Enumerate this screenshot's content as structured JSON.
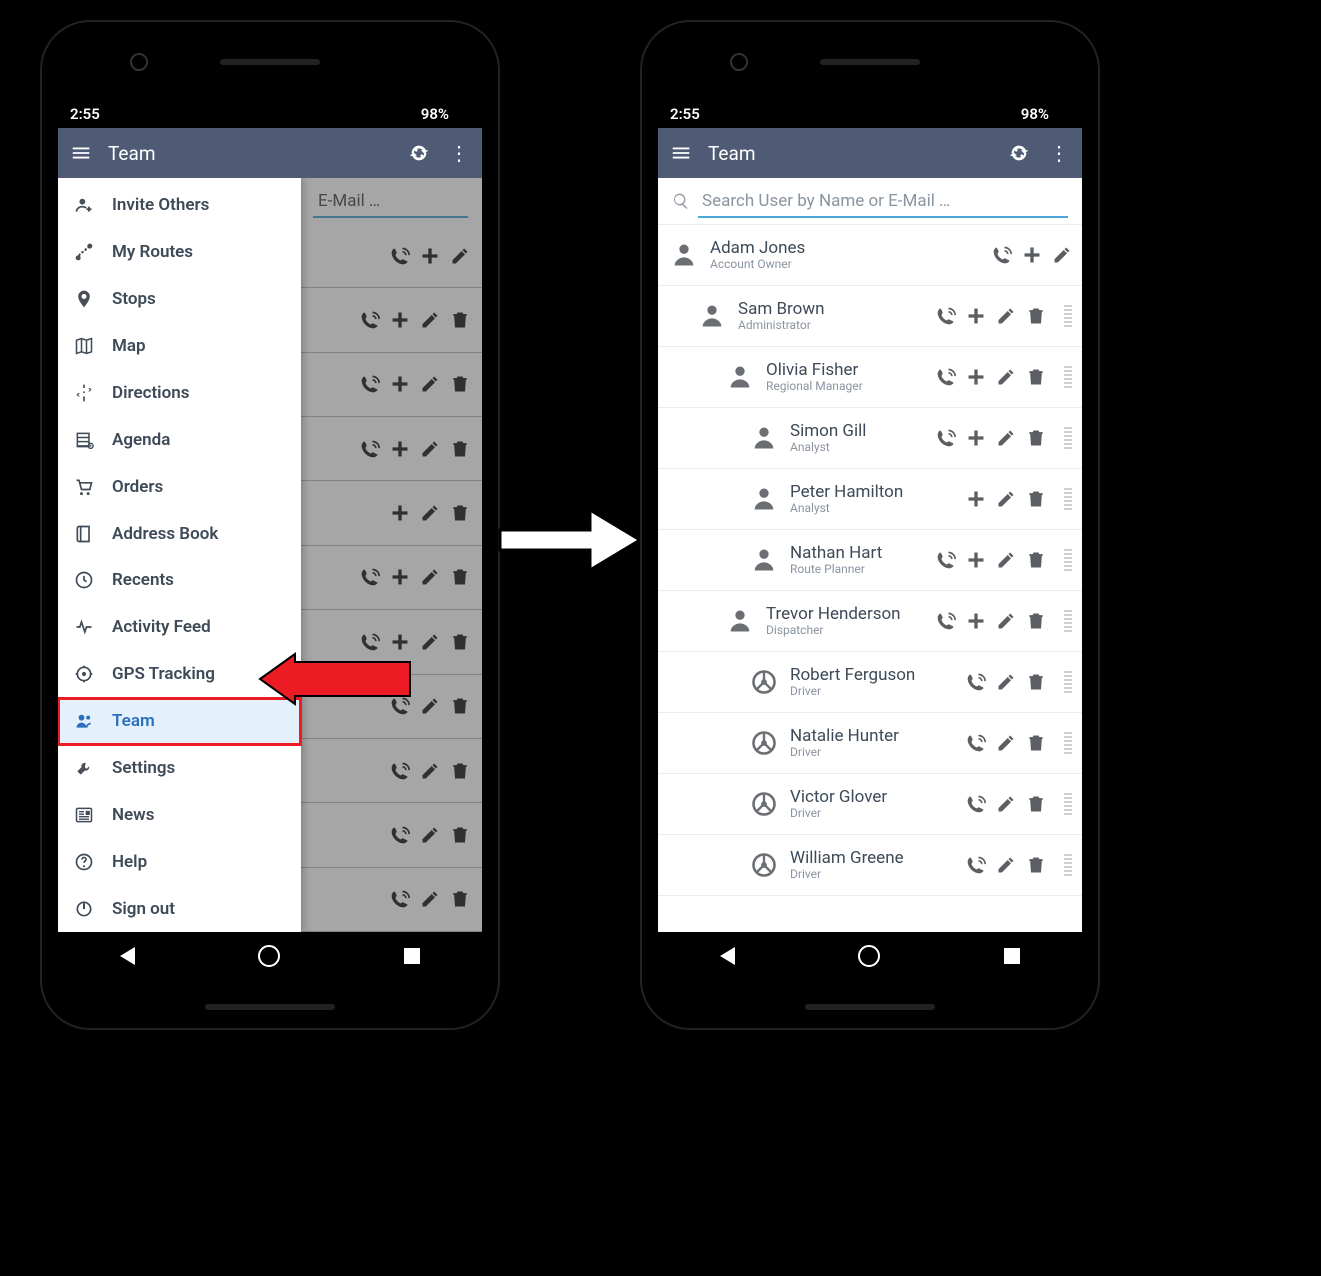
{
  "status": {
    "time": "2:55",
    "battery": "98%"
  },
  "appbar": {
    "title": "Team"
  },
  "search": {
    "placeholder": "Search User by Name or E-Mail …",
    "placeholder_trunc": "E-Mail …"
  },
  "drawer": {
    "items": [
      {
        "label": "Invite Others",
        "icon": "user-plus"
      },
      {
        "label": "My Routes",
        "icon": "route"
      },
      {
        "label": "Stops",
        "icon": "pin"
      },
      {
        "label": "Map",
        "icon": "map"
      },
      {
        "label": "Directions",
        "icon": "signpost"
      },
      {
        "label": "Agenda",
        "icon": "agenda"
      },
      {
        "label": "Orders",
        "icon": "cart"
      },
      {
        "label": "Address Book",
        "icon": "book"
      },
      {
        "label": "Recents",
        "icon": "clock"
      },
      {
        "label": "Activity Feed",
        "icon": "pulse"
      },
      {
        "label": "GPS Tracking",
        "icon": "target"
      },
      {
        "label": "Team",
        "icon": "team",
        "active": true
      },
      {
        "label": "Settings",
        "icon": "wrench"
      },
      {
        "label": "News",
        "icon": "news"
      },
      {
        "label": "Help",
        "icon": "help"
      },
      {
        "label": "Sign out",
        "icon": "power"
      }
    ]
  },
  "bg_rows": [
    {
      "call": true,
      "add": true,
      "edit": true,
      "trash": false
    },
    {
      "call": true,
      "add": true,
      "edit": true,
      "trash": true
    },
    {
      "call": true,
      "add": true,
      "edit": true,
      "trash": true
    },
    {
      "call": true,
      "add": true,
      "edit": true,
      "trash": true
    },
    {
      "call": false,
      "add": true,
      "edit": true,
      "trash": true
    },
    {
      "call": true,
      "add": true,
      "edit": true,
      "trash": true
    },
    {
      "call": true,
      "add": true,
      "edit": true,
      "trash": true
    },
    {
      "call": true,
      "add": false,
      "edit": true,
      "trash": true
    },
    {
      "call": true,
      "add": false,
      "edit": true,
      "trash": true
    },
    {
      "call": true,
      "add": false,
      "edit": true,
      "trash": true
    },
    {
      "call": true,
      "add": false,
      "edit": true,
      "trash": true
    }
  ],
  "team": [
    {
      "name": "Adam Jones",
      "role": "Account Owner",
      "indent": 0,
      "avatar": "owner",
      "call": true,
      "add": true,
      "edit": true,
      "trash": false,
      "grip": false
    },
    {
      "name": "Sam Brown",
      "role": "Administrator",
      "indent": 1,
      "avatar": "admin",
      "call": true,
      "add": true,
      "edit": true,
      "trash": true,
      "grip": true
    },
    {
      "name": "Olivia Fisher",
      "role": "Regional Manager",
      "indent": 2,
      "avatar": "regional",
      "call": true,
      "add": true,
      "edit": true,
      "trash": true,
      "grip": true
    },
    {
      "name": "Simon Gill",
      "role": "Analyst",
      "indent": 3,
      "avatar": "analyst",
      "call": true,
      "add": true,
      "edit": true,
      "trash": true,
      "grip": true
    },
    {
      "name": "Peter Hamilton",
      "role": "Analyst",
      "indent": 3,
      "avatar": "analyst",
      "call": false,
      "add": true,
      "edit": true,
      "trash": true,
      "grip": true
    },
    {
      "name": "Nathan Hart",
      "role": "Route Planner",
      "indent": 3,
      "avatar": "planner",
      "call": true,
      "add": true,
      "edit": true,
      "trash": true,
      "grip": true
    },
    {
      "name": "Trevor Henderson",
      "role": "Dispatcher",
      "indent": 2,
      "avatar": "dispatcher",
      "call": true,
      "add": true,
      "edit": true,
      "trash": true,
      "grip": true
    },
    {
      "name": "Robert Ferguson",
      "role": "Driver",
      "indent": 3,
      "avatar": "driver",
      "call": true,
      "add": false,
      "edit": true,
      "trash": true,
      "grip": true
    },
    {
      "name": "Natalie Hunter",
      "role": "Driver",
      "indent": 3,
      "avatar": "driver",
      "call": true,
      "add": false,
      "edit": true,
      "trash": true,
      "grip": true
    },
    {
      "name": "Victor Glover",
      "role": "Driver",
      "indent": 3,
      "avatar": "driver",
      "call": true,
      "add": false,
      "edit": true,
      "trash": true,
      "grip": true
    },
    {
      "name": "William Greene",
      "role": "Driver",
      "indent": 3,
      "avatar": "driver",
      "call": true,
      "add": false,
      "edit": true,
      "trash": true,
      "grip": true
    }
  ]
}
